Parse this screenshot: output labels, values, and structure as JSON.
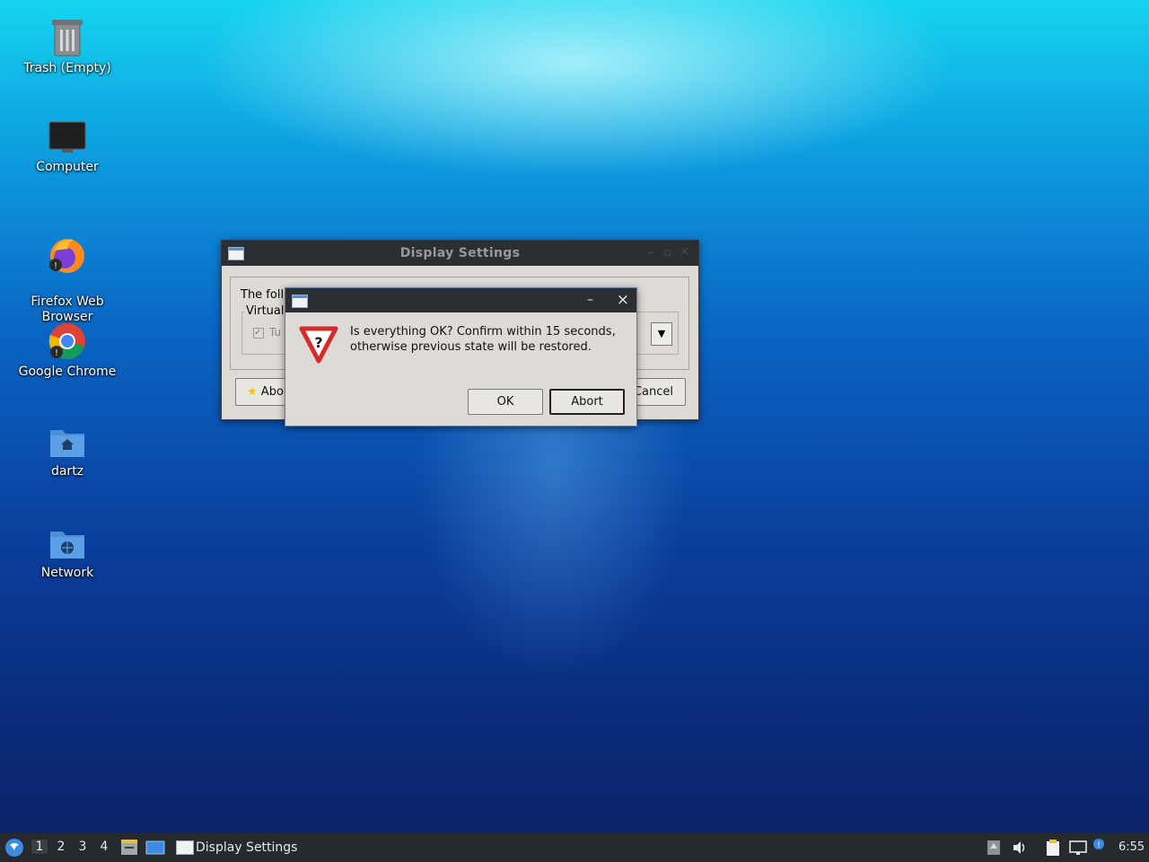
{
  "desktop": {
    "icons": [
      {
        "label": "Trash (Empty)",
        "icon": "trash-icon"
      },
      {
        "label": "Computer",
        "icon": "computer-icon"
      },
      {
        "label": "Firefox Web\nBrowser",
        "icon": "firefox-icon"
      },
      {
        "label": "Google Chrome",
        "icon": "chrome-icon"
      },
      {
        "label": "dartz",
        "icon": "home-folder-icon"
      },
      {
        "label": "Network",
        "icon": "network-folder-icon"
      }
    ]
  },
  "display_settings": {
    "title": "Display Settings",
    "intro_text": "The foll",
    "group_label": "Virtual",
    "checkbox_label": "Tu",
    "checkbox_checked": true,
    "about_label": "Abo",
    "cancel_label": "Cancel"
  },
  "confirm_dialog": {
    "minimize_glyph": "–",
    "close_glyph": "×",
    "message_line1": "Is everything OK? Confirm within 15 seconds,",
    "message_line2": "otherwise previous state will be restored.",
    "ok_label": "OK",
    "abort_label": "Abort",
    "icon": "warning-question-icon"
  },
  "taskbar": {
    "workspaces": [
      "1",
      "2",
      "3",
      "4"
    ],
    "active_workspace": "1",
    "task_label": "Display Settings",
    "clock": "6:55"
  }
}
